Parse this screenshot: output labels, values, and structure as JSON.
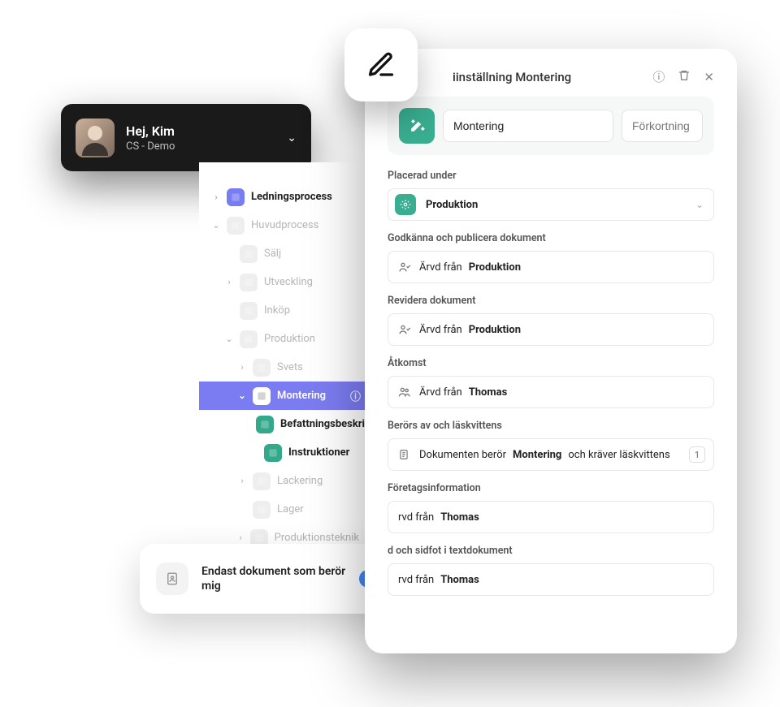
{
  "user": {
    "greeting": "Hej, Kim",
    "sub": "CS - Demo"
  },
  "tree": [
    {
      "label": "Ledningsprocess",
      "level": 0,
      "arrow": "›",
      "style": "bold",
      "icon": "iris"
    },
    {
      "label": "Huvudprocess",
      "level": 0,
      "arrow": "⌄",
      "style": "muted",
      "icon": "gray"
    },
    {
      "label": "Sälj",
      "level": 1,
      "arrow": "",
      "style": "muted",
      "icon": "gray"
    },
    {
      "label": "Utveckling",
      "level": 1,
      "arrow": "›",
      "style": "muted",
      "icon": "gray"
    },
    {
      "label": "Inköp",
      "level": 1,
      "arrow": "",
      "style": "muted",
      "icon": "gray"
    },
    {
      "label": "Produktion",
      "level": 1,
      "arrow": "⌄",
      "style": "muted",
      "icon": "gray"
    },
    {
      "label": "Svets",
      "level": 2,
      "arrow": "›",
      "style": "muted",
      "icon": "gray"
    },
    {
      "label": "Montering",
      "level": 2,
      "arrow": "⌄",
      "style": "sel",
      "icon": "white",
      "info": true
    },
    {
      "label": "Befattningsbeskriv",
      "level": 3,
      "arrow": "",
      "style": "bold",
      "icon": "green"
    },
    {
      "label": "Instruktioner",
      "level": 3,
      "arrow": "",
      "style": "bold",
      "icon": "green"
    },
    {
      "label": "Lackering",
      "level": 2,
      "arrow": "›",
      "style": "muted",
      "icon": "gray"
    },
    {
      "label": "Lager",
      "level": 2,
      "arrow": "",
      "style": "muted",
      "icon": "gray"
    },
    {
      "label": "Produktionsteknik",
      "level": 2,
      "arrow": "›",
      "style": "muted",
      "icon": "gray"
    }
  ],
  "filter": {
    "label": "Endast dokument som berör mig"
  },
  "panel": {
    "title": "iinställning Montering",
    "name_value": "Montering",
    "abbr_placeholder": "Förkortning",
    "sections": {
      "placed_label": "Placerad under",
      "placed_value": "Produktion",
      "approve_label": "Godkänna och publicera dokument",
      "approve_prefix": "Ärvd från ",
      "approve_value": "Produktion",
      "revise_label": "Revidera dokument",
      "revise_prefix": "Ärvd från ",
      "revise_value": "Produktion",
      "access_label": "Åtkomst",
      "access_prefix": "Ärvd från ",
      "access_value": "Thomas",
      "concern_label": "Berörs av och läskvittens",
      "concern_p1": "Dokumenten berör ",
      "concern_p2": "Montering",
      "concern_p3": " och kräver läskvittens",
      "concern_count": "1",
      "company_label": "Företagsinformation",
      "company_prefix": "rvd från ",
      "company_value": "Thomas",
      "hf_label": "d och sidfot i textdokument",
      "hf_prefix": "rvd från ",
      "hf_value": "Thomas"
    }
  }
}
